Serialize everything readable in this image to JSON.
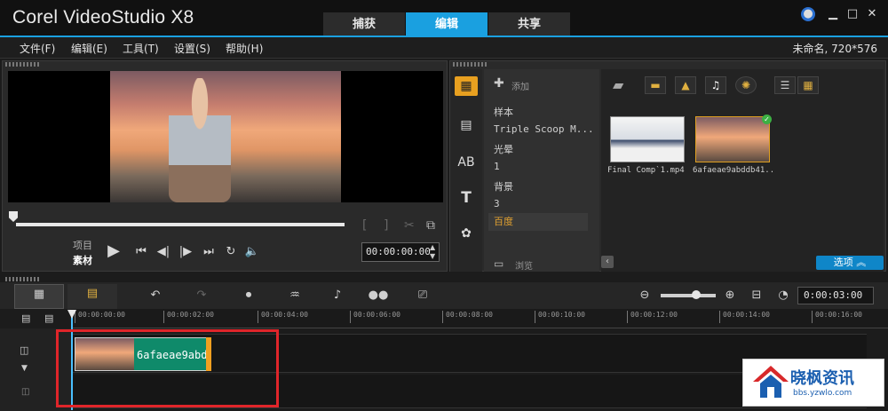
{
  "window": {
    "title": "Corel VideoStudio X8",
    "project_info": "未命名, 720*576"
  },
  "step_tabs": [
    {
      "label": "捕获",
      "active": false
    },
    {
      "label": "编辑",
      "active": true
    },
    {
      "label": "共享",
      "active": false
    }
  ],
  "menu": [
    "文件(F)",
    "编辑(E)",
    "工具(T)",
    "设置(S)",
    "帮助(H)"
  ],
  "player": {
    "mode_project": "项目",
    "mode_clip": "素材",
    "timecode": "00:00:00:00",
    "scrub_position": 0
  },
  "library": {
    "add_label": "添加",
    "browse_label": "浏览",
    "folders": [
      "样本",
      "Triple Scoop M...",
      "光晕",
      "1",
      "背景",
      "3",
      "百度"
    ],
    "selected_folder": "百度",
    "thumbnails": [
      {
        "label": "Final Comp`1.mp4"
      },
      {
        "label": "6afaeae9abddb41..."
      }
    ],
    "options_label": "选项"
  },
  "timeline": {
    "duration": "0:00:03:00",
    "ruler_ticks": [
      "00:00:00:00",
      "00:00:02:00",
      "00:00:04:00",
      "00:00:06:00",
      "00:00:08:00",
      "00:00:10:00",
      "00:00:12:00",
      "00:00:14:00",
      "00:00:16:00"
    ],
    "clip_label": "6afaeae9abd",
    "zoom_level": 0.56
  },
  "watermark": {
    "title": "晓枫资讯",
    "url": "bbs.yzwlo.com"
  },
  "colors": {
    "accent": "#1aa0e0",
    "clip": "#0f8a6a",
    "highlight": "#e0252a",
    "selected_folder": "#e0a030"
  }
}
